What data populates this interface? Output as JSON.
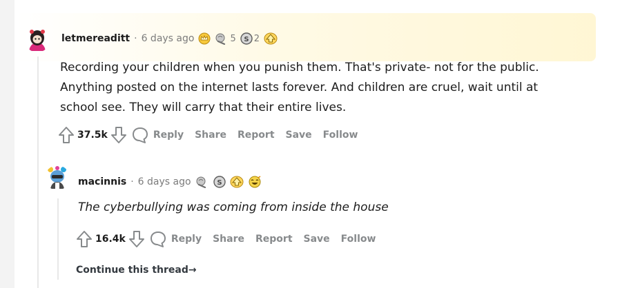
{
  "comments": [
    {
      "username": "letmereaditt",
      "separator": "·",
      "time": "6 days ago",
      "awards": [
        {
          "icon": "gold-crown-award-icon",
          "count": ""
        },
        {
          "icon": "helpful-award-icon",
          "count": "5"
        },
        {
          "icon": "silver-coin-award-icon",
          "count": "2"
        },
        {
          "icon": "upvote-award-icon",
          "count": ""
        }
      ],
      "body_lines": [
        "Recording your children when you punish them. That's private- not for the public.",
        "Anything posted on the internet lasts forever. And children are cruel, wait until at",
        "school see. They will carry that their entire lives."
      ],
      "score": "37.5k",
      "actions": {
        "reply": "Reply",
        "share": "Share",
        "report": "Report",
        "save": "Save",
        "follow": "Follow"
      }
    },
    {
      "username": "macinnis",
      "separator": "·",
      "time": "6 days ago",
      "awards": [
        {
          "icon": "helpful-award-icon",
          "count": ""
        },
        {
          "icon": "silver-coin-award-icon",
          "count": ""
        },
        {
          "icon": "upvote-award-icon",
          "count": ""
        },
        {
          "icon": "laughing-award-icon",
          "count": ""
        }
      ],
      "body": "The cyberbullying was coming from inside the house",
      "score": "16.4k",
      "actions": {
        "reply": "Reply",
        "share": "Share",
        "report": "Report",
        "save": "Save",
        "follow": "Follow"
      }
    }
  ],
  "continue_thread": "Continue this thread",
  "continue_arrow": "→",
  "colors": {
    "background": "#f3f3f3",
    "panel": "#ffffff",
    "highlight": "#fff6d2",
    "action_gray": "#878a8c",
    "text": "#1c1c1c"
  }
}
